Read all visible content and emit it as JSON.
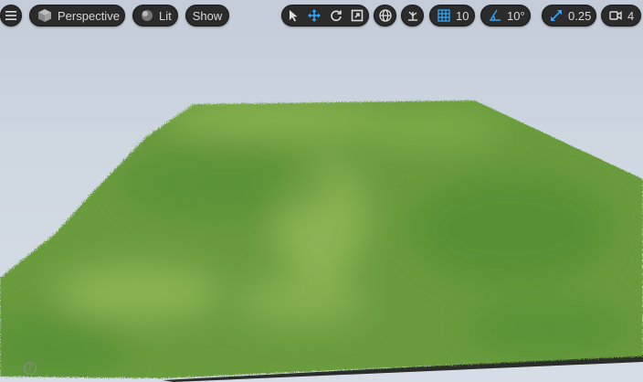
{
  "toolbar": {
    "view_mode_label": "Perspective",
    "lighting_label": "Lit",
    "show_label": "Show",
    "grid_snap_value": "10",
    "rotation_snap_value": "10°",
    "scale_snap_value": "0.25",
    "camera_speed_value": "4"
  },
  "icons": [
    "menu-icon",
    "perspective-cube-icon",
    "lit-sphere-icon",
    "select-arrow-icon",
    "translate-icon",
    "rotate-icon",
    "scale-icon",
    "world-local-icon",
    "surface-snap-icon",
    "grid-snap-icon",
    "rotation-snap-icon",
    "scale-snap-icon",
    "camera-speed-icon",
    "help-icon"
  ],
  "colors": {
    "toolbar_bg": "#2b2b2b",
    "accent_blue": "#2ea8ff",
    "sky": "#c8d1dc",
    "grass": "#5f9a3a"
  },
  "help_glyph": "?"
}
